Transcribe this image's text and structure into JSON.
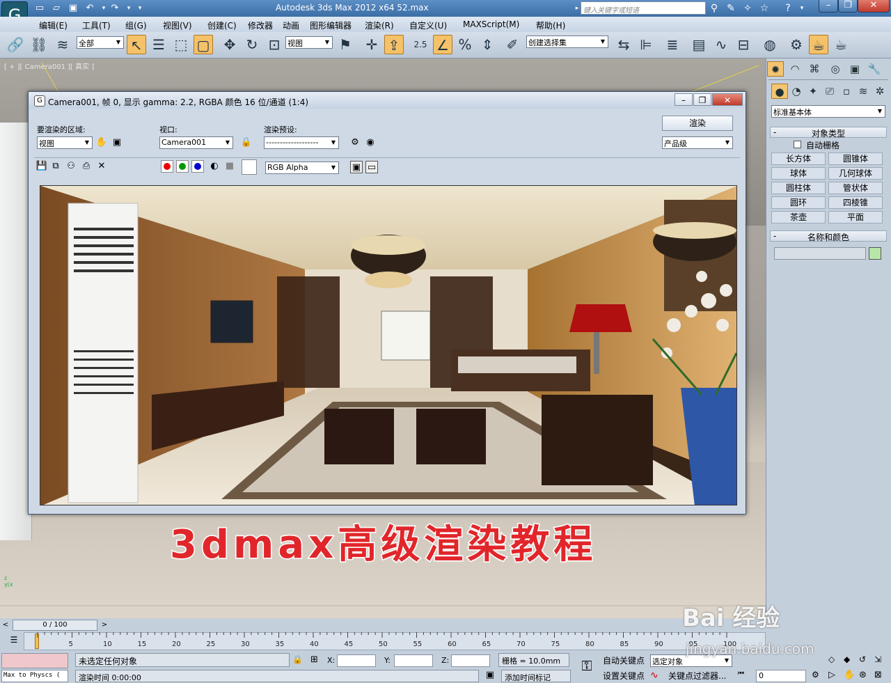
{
  "titlebar": {
    "app_title": "Autodesk 3ds Max  2012 x64       52.max",
    "search_placeholder": "键入关键字或短语",
    "icons": [
      "new-icon",
      "open-icon",
      "save-icon",
      "undo-icon",
      "redo-icon",
      "search-binoculars-icon",
      "help-icon"
    ]
  },
  "menu": [
    "编辑(E)",
    "工具(T)",
    "组(G)",
    "视图(V)",
    "创建(C)",
    "修改器",
    "动画",
    "图形编辑器",
    "渲染(R)",
    "自定义(U)",
    "MAXScript(M)",
    "帮助(H)"
  ],
  "toolbar": {
    "selection_filter": "全部",
    "ref_coord": "视图",
    "snap_value": "2.5",
    "named_sets": "创建选择集"
  },
  "viewport": {
    "label": "[ + ][ Camera001 ][ 真实 ]"
  },
  "render_dialog": {
    "title": "Camera001, 帧 0, 显示 gamma: 2.2, RGBA 颜色 16 位/通道 (1:4)",
    "area_label": "要渲染的区域:",
    "area_value": "视图",
    "viewport_label": "视口:",
    "viewport_value": "Camera001",
    "preset_label": "渲染预设:",
    "preset_value": "-------------------",
    "render_button": "渲染",
    "quality_value": "产品级",
    "channel_value": "RGB Alpha"
  },
  "command_panel": {
    "category": "标准基本体",
    "object_type_title": "对象类型",
    "autogrid": "自动栅格",
    "primitives": [
      "长方体",
      "圆锥体",
      "球体",
      "几何球体",
      "圆柱体",
      "管状体",
      "圆环",
      "四棱锥",
      "茶壶",
      "平面"
    ],
    "name_color_title": "名称和颜色",
    "object_color": "#b8e6a8"
  },
  "timeline": {
    "frame_counter": "0 / 100",
    "ticks": [
      "5",
      "10",
      "15",
      "20",
      "25",
      "30",
      "35",
      "40",
      "45",
      "50",
      "55",
      "60",
      "65",
      "70",
      "75",
      "80",
      "85",
      "90",
      "95",
      "100"
    ]
  },
  "status": {
    "script_listener": "Max to Physcs (",
    "selection": "未选定任何对象",
    "render_time": "渲染时间  0:00:00",
    "x_label": "X:",
    "y_label": "Y:",
    "z_label": "Z:",
    "grid": "栅格 = 10.0mm",
    "add_time_tag": "添加时间标记",
    "auto_key": "自动关键点",
    "set_key": "设置关键点",
    "selected_object": "选定对象",
    "key_filters": "关键点过滤器...",
    "frame_field": "0"
  },
  "overlay": {
    "banner": "3dmax高级渲染教程",
    "watermark": "Bai 经验",
    "watermark_url": "jingyan.baidu.com"
  }
}
